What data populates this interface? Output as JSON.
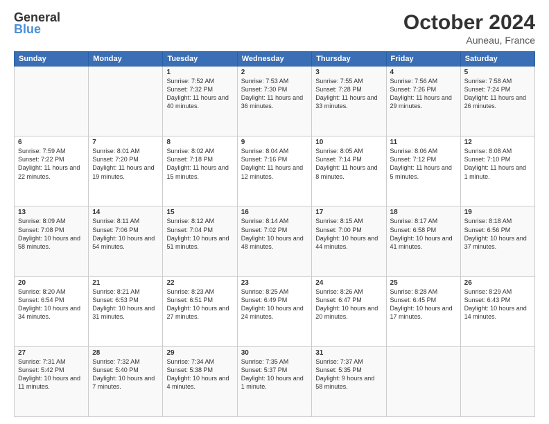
{
  "header": {
    "logo_line1": "General",
    "logo_line2": "Blue",
    "month": "October 2024",
    "location": "Auneau, France"
  },
  "days_of_week": [
    "Sunday",
    "Monday",
    "Tuesday",
    "Wednesday",
    "Thursday",
    "Friday",
    "Saturday"
  ],
  "weeks": [
    [
      {
        "day": "",
        "info": ""
      },
      {
        "day": "",
        "info": ""
      },
      {
        "day": "1",
        "info": "Sunrise: 7:52 AM\nSunset: 7:32 PM\nDaylight: 11 hours and 40 minutes."
      },
      {
        "day": "2",
        "info": "Sunrise: 7:53 AM\nSunset: 7:30 PM\nDaylight: 11 hours and 36 minutes."
      },
      {
        "day": "3",
        "info": "Sunrise: 7:55 AM\nSunset: 7:28 PM\nDaylight: 11 hours and 33 minutes."
      },
      {
        "day": "4",
        "info": "Sunrise: 7:56 AM\nSunset: 7:26 PM\nDaylight: 11 hours and 29 minutes."
      },
      {
        "day": "5",
        "info": "Sunrise: 7:58 AM\nSunset: 7:24 PM\nDaylight: 11 hours and 26 minutes."
      }
    ],
    [
      {
        "day": "6",
        "info": "Sunrise: 7:59 AM\nSunset: 7:22 PM\nDaylight: 11 hours and 22 minutes."
      },
      {
        "day": "7",
        "info": "Sunrise: 8:01 AM\nSunset: 7:20 PM\nDaylight: 11 hours and 19 minutes."
      },
      {
        "day": "8",
        "info": "Sunrise: 8:02 AM\nSunset: 7:18 PM\nDaylight: 11 hours and 15 minutes."
      },
      {
        "day": "9",
        "info": "Sunrise: 8:04 AM\nSunset: 7:16 PM\nDaylight: 11 hours and 12 minutes."
      },
      {
        "day": "10",
        "info": "Sunrise: 8:05 AM\nSunset: 7:14 PM\nDaylight: 11 hours and 8 minutes."
      },
      {
        "day": "11",
        "info": "Sunrise: 8:06 AM\nSunset: 7:12 PM\nDaylight: 11 hours and 5 minutes."
      },
      {
        "day": "12",
        "info": "Sunrise: 8:08 AM\nSunset: 7:10 PM\nDaylight: 11 hours and 1 minute."
      }
    ],
    [
      {
        "day": "13",
        "info": "Sunrise: 8:09 AM\nSunset: 7:08 PM\nDaylight: 10 hours and 58 minutes."
      },
      {
        "day": "14",
        "info": "Sunrise: 8:11 AM\nSunset: 7:06 PM\nDaylight: 10 hours and 54 minutes."
      },
      {
        "day": "15",
        "info": "Sunrise: 8:12 AM\nSunset: 7:04 PM\nDaylight: 10 hours and 51 minutes."
      },
      {
        "day": "16",
        "info": "Sunrise: 8:14 AM\nSunset: 7:02 PM\nDaylight: 10 hours and 48 minutes."
      },
      {
        "day": "17",
        "info": "Sunrise: 8:15 AM\nSunset: 7:00 PM\nDaylight: 10 hours and 44 minutes."
      },
      {
        "day": "18",
        "info": "Sunrise: 8:17 AM\nSunset: 6:58 PM\nDaylight: 10 hours and 41 minutes."
      },
      {
        "day": "19",
        "info": "Sunrise: 8:18 AM\nSunset: 6:56 PM\nDaylight: 10 hours and 37 minutes."
      }
    ],
    [
      {
        "day": "20",
        "info": "Sunrise: 8:20 AM\nSunset: 6:54 PM\nDaylight: 10 hours and 34 minutes."
      },
      {
        "day": "21",
        "info": "Sunrise: 8:21 AM\nSunset: 6:53 PM\nDaylight: 10 hours and 31 minutes."
      },
      {
        "day": "22",
        "info": "Sunrise: 8:23 AM\nSunset: 6:51 PM\nDaylight: 10 hours and 27 minutes."
      },
      {
        "day": "23",
        "info": "Sunrise: 8:25 AM\nSunset: 6:49 PM\nDaylight: 10 hours and 24 minutes."
      },
      {
        "day": "24",
        "info": "Sunrise: 8:26 AM\nSunset: 6:47 PM\nDaylight: 10 hours and 20 minutes."
      },
      {
        "day": "25",
        "info": "Sunrise: 8:28 AM\nSunset: 6:45 PM\nDaylight: 10 hours and 17 minutes."
      },
      {
        "day": "26",
        "info": "Sunrise: 8:29 AM\nSunset: 6:43 PM\nDaylight: 10 hours and 14 minutes."
      }
    ],
    [
      {
        "day": "27",
        "info": "Sunrise: 7:31 AM\nSunset: 5:42 PM\nDaylight: 10 hours and 11 minutes."
      },
      {
        "day": "28",
        "info": "Sunrise: 7:32 AM\nSunset: 5:40 PM\nDaylight: 10 hours and 7 minutes."
      },
      {
        "day": "29",
        "info": "Sunrise: 7:34 AM\nSunset: 5:38 PM\nDaylight: 10 hours and 4 minutes."
      },
      {
        "day": "30",
        "info": "Sunrise: 7:35 AM\nSunset: 5:37 PM\nDaylight: 10 hours and 1 minute."
      },
      {
        "day": "31",
        "info": "Sunrise: 7:37 AM\nSunset: 5:35 PM\nDaylight: 9 hours and 58 minutes."
      },
      {
        "day": "",
        "info": ""
      },
      {
        "day": "",
        "info": ""
      }
    ]
  ]
}
